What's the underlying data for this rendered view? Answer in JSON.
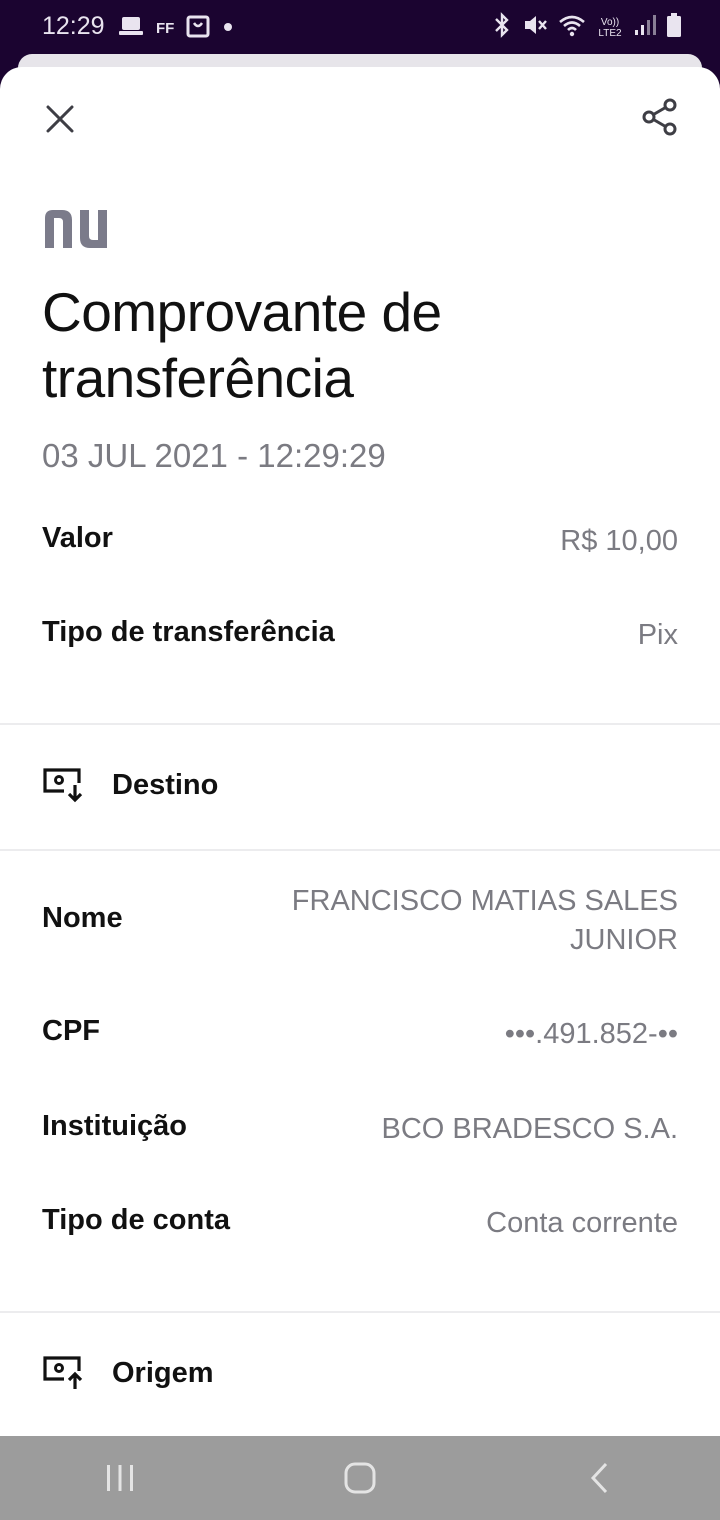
{
  "status_bar": {
    "time": "12:29",
    "left_icons": [
      "laptop-icon",
      "ff-icon",
      "shopping-bag-icon",
      "dot-icon"
    ],
    "ff_text": "FF",
    "right_icons": [
      "bluetooth-icon",
      "mute-icon",
      "wifi-icon",
      "volte-icon",
      "signal-icon",
      "battery-icon"
    ],
    "volte_text": "Vo)) LTE2"
  },
  "header": {
    "close_icon": "close-icon",
    "share_icon": "share-icon"
  },
  "brand": {
    "logo_text": "nu",
    "color": "#7b7b8a"
  },
  "title": "Comprovante de transferência",
  "datetime": "03 JUL 2021 - 12:29:29",
  "summary": [
    {
      "label": "Valor",
      "value": "R$ 10,00"
    },
    {
      "label": "Tipo de transferência",
      "value": "Pix"
    }
  ],
  "destino": {
    "icon": "download-receipt-icon",
    "label": "Destino",
    "rows": [
      {
        "label": "Nome",
        "value": "FRANCISCO MATIAS SALES JUNIOR"
      },
      {
        "label": "CPF",
        "value": "•••.491.852-••"
      },
      {
        "label": "Instituição",
        "value": "BCO BRADESCO S.A."
      },
      {
        "label": "Tipo de conta",
        "value": "Conta corrente"
      }
    ]
  },
  "origem": {
    "icon": "upload-receipt-icon",
    "label": "Origem"
  },
  "nav_bar": {
    "buttons": [
      "recents-icon",
      "home-icon",
      "back-icon"
    ]
  }
}
